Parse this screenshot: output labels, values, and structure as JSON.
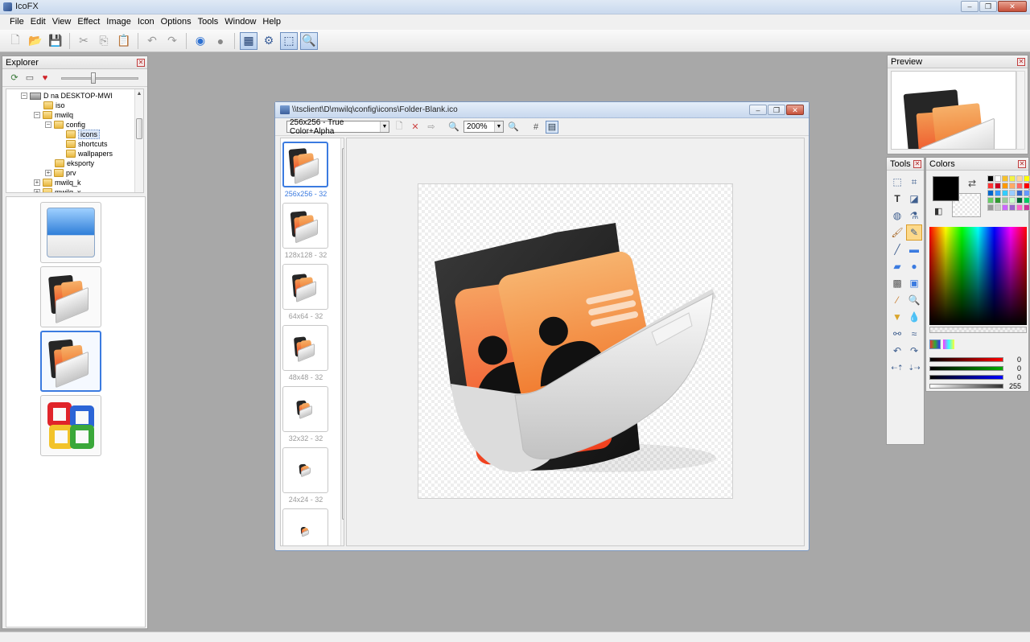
{
  "app": {
    "title": "IcoFX"
  },
  "menu": [
    "File",
    "Edit",
    "View",
    "Effect",
    "Image",
    "Icon",
    "Options",
    "Tools",
    "Window",
    "Help"
  ],
  "toolbar": {
    "icons": [
      "new-icon",
      "open-icon",
      "save-icon",
      "cut-icon",
      "copy-icon",
      "paste-icon",
      "undo-icon",
      "redo-icon",
      "windows-icon",
      "apple-icon",
      "view-icon",
      "batch-icon",
      "capture-icon",
      "zoom-icon"
    ]
  },
  "explorer": {
    "title": "Explorer",
    "tree": [
      {
        "label": "D na DESKTOP-MWI",
        "kind": "drive",
        "expanded": true
      },
      {
        "label": "iso",
        "kind": "folder"
      },
      {
        "label": "mwilq",
        "kind": "folder",
        "expanded": true
      },
      {
        "label": "config",
        "kind": "folder",
        "expanded": true
      },
      {
        "label": "icons",
        "kind": "folder",
        "selected": true
      },
      {
        "label": "shortcuts",
        "kind": "folder"
      },
      {
        "label": "wallpapers",
        "kind": "folder"
      },
      {
        "label": "eksporty",
        "kind": "folder"
      },
      {
        "label": "prv",
        "kind": "folder",
        "collapsed": true
      },
      {
        "label": "mwilq_k",
        "kind": "folder",
        "collapsed": true
      },
      {
        "label": "mwilq_x",
        "kind": "folder",
        "collapsed": true
      }
    ],
    "thumbnails": [
      "windows-explorer-icon",
      "contacts-folder-icon",
      "contacts-folder-icon",
      "office-icon"
    ],
    "selected_thumbnail": 2
  },
  "document": {
    "title": "\\\\tsclient\\D\\mwilq\\config\\icons\\Folder-Blank.ico",
    "format_select": "256x256 - True Color+Alpha",
    "zoom": "200%",
    "formats": [
      {
        "caption": "256x256 - 32",
        "selected": true
      },
      {
        "caption": "128x128 - 32"
      },
      {
        "caption": "64x64 - 32"
      },
      {
        "caption": "48x48 - 32"
      },
      {
        "caption": "32x32 - 32"
      },
      {
        "caption": "24x24 - 32"
      },
      {
        "caption": ""
      }
    ]
  },
  "preview": {
    "title": "Preview"
  },
  "tools": {
    "title": "Tools"
  },
  "colors": {
    "title": "Colors",
    "primary": "#000000",
    "red": "0",
    "green": "0",
    "blue": "0",
    "alpha": "255"
  }
}
